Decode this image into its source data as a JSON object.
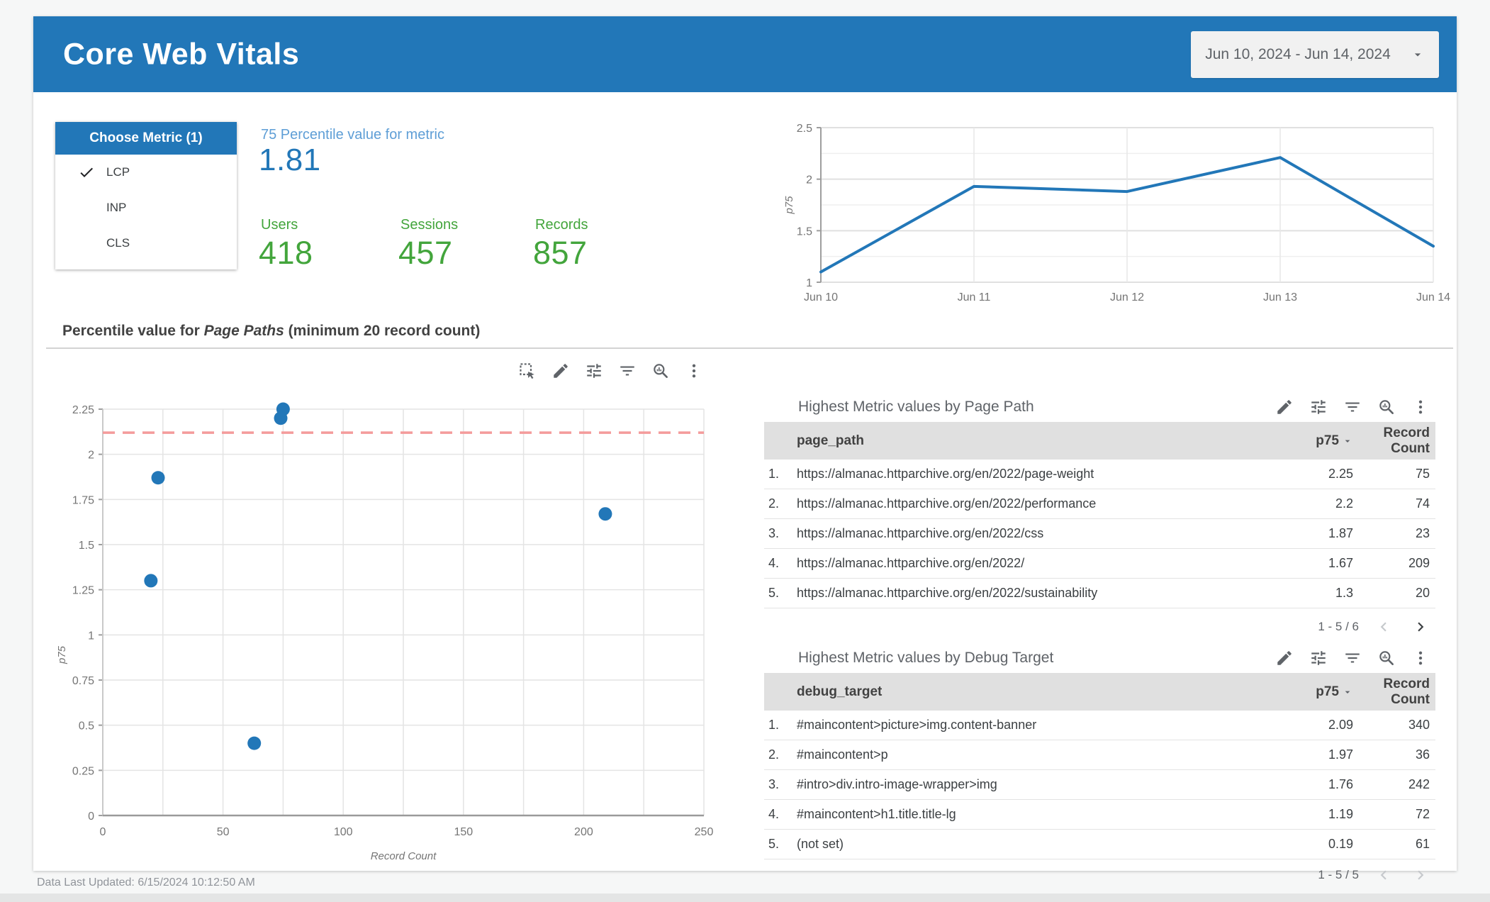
{
  "header": {
    "title": "Core Web Vitals",
    "date_range": "Jun 10, 2024 - Jun 14, 2024"
  },
  "metric_selector": {
    "title": "Choose Metric (1)",
    "options": [
      {
        "label": "LCP",
        "selected": true
      },
      {
        "label": "INP",
        "selected": false
      },
      {
        "label": "CLS",
        "selected": false
      }
    ]
  },
  "scorecards": {
    "percentile": {
      "label": "75 Percentile value for metric",
      "value": "1.81"
    },
    "users": {
      "label": "Users",
      "value": "418"
    },
    "sessions": {
      "label": "Sessions",
      "value": "457"
    },
    "records": {
      "label": "Records",
      "value": "857"
    }
  },
  "section": {
    "title_prefix": "Percentile value for ",
    "title_italic": "Page Paths",
    "title_suffix": " (minimum 20 record count)"
  },
  "chart_data": [
    {
      "id": "p75-trend",
      "type": "line",
      "title": "p75 by date",
      "xlabel": "",
      "ylabel": "p75",
      "categories": [
        "Jun 10",
        "Jun 11",
        "Jun 12",
        "Jun 13",
        "Jun 14"
      ],
      "values": [
        1.1,
        1.93,
        1.88,
        2.21,
        1.35
      ],
      "ylim": [
        1,
        2.5
      ],
      "ytick_step": 0.25,
      "ylabel_ticks": [
        1,
        1.5,
        2,
        2.5
      ],
      "grid": true,
      "legend": "none",
      "line_color": "#2277b8"
    },
    {
      "id": "p75-scatter",
      "type": "scatter",
      "title": "Percentile value for Page Paths (minimum 20 record count)",
      "xlabel": "Record Count",
      "ylabel": "p75",
      "points": [
        {
          "x": 75,
          "y": 2.25
        },
        {
          "x": 74,
          "y": 2.2
        },
        {
          "x": 23,
          "y": 1.87
        },
        {
          "x": 209,
          "y": 1.67
        },
        {
          "x": 20,
          "y": 1.3
        },
        {
          "x": 63,
          "y": 0.4
        }
      ],
      "xlim": [
        0,
        250
      ],
      "ylim": [
        0,
        2.25
      ],
      "xtick_step": 25,
      "xlabel_every": 50,
      "ytick_step": 0.25,
      "grid": true,
      "reference_line": {
        "y": 2.12,
        "style": "dashed",
        "color": "#f49b9b"
      },
      "point_color": "#2277b8"
    }
  ],
  "tables": [
    {
      "title": "Highest Metric values by Page Path",
      "columns": [
        "page_path",
        "p75",
        "Record Count"
      ],
      "sorted_by": "p75",
      "rows": [
        {
          "index": "1.",
          "key": "https://almanac.httparchive.org/en/2022/page-weight",
          "p75": "2.25",
          "count": "75"
        },
        {
          "index": "2.",
          "key": "https://almanac.httparchive.org/en/2022/performance",
          "p75": "2.2",
          "count": "74"
        },
        {
          "index": "3.",
          "key": "https://almanac.httparchive.org/en/2022/css",
          "p75": "1.87",
          "count": "23"
        },
        {
          "index": "4.",
          "key": "https://almanac.httparchive.org/en/2022/",
          "p75": "1.67",
          "count": "209"
        },
        {
          "index": "5.",
          "key": "https://almanac.httparchive.org/en/2022/sustainability",
          "p75": "1.3",
          "count": "20"
        }
      ],
      "pagination": {
        "label": "1 - 5 / 6",
        "prev_enabled": false,
        "next_enabled": true
      }
    },
    {
      "title": "Highest Metric values by Debug Target",
      "columns": [
        "debug_target",
        "p75",
        "Record Count"
      ],
      "sorted_by": "p75",
      "rows": [
        {
          "index": "1.",
          "key": "#maincontent>picture>img.content-banner",
          "p75": "2.09",
          "count": "340"
        },
        {
          "index": "2.",
          "key": "#maincontent>p",
          "p75": "1.97",
          "count": "36"
        },
        {
          "index": "3.",
          "key": "#intro>div.intro-image-wrapper>img",
          "p75": "1.76",
          "count": "242"
        },
        {
          "index": "4.",
          "key": "#maincontent>h1.title.title-lg",
          "p75": "1.19",
          "count": "72"
        },
        {
          "index": "5.",
          "key": "(not set)",
          "p75": "0.19",
          "count": "61"
        }
      ],
      "pagination": {
        "label": "1 - 5 / 5",
        "prev_enabled": false,
        "next_enabled": false
      }
    }
  ],
  "footer": {
    "last_updated": "Data Last Updated: 6/15/2024 10:12:50 AM"
  },
  "colors": {
    "header_blue": "#2277b8",
    "score_label_blue": "#5e9ed6",
    "score_value_blue": "#2277b8",
    "score_green": "#43a53c",
    "axis_text": "#757575",
    "reference_red": "#f49b9b"
  }
}
